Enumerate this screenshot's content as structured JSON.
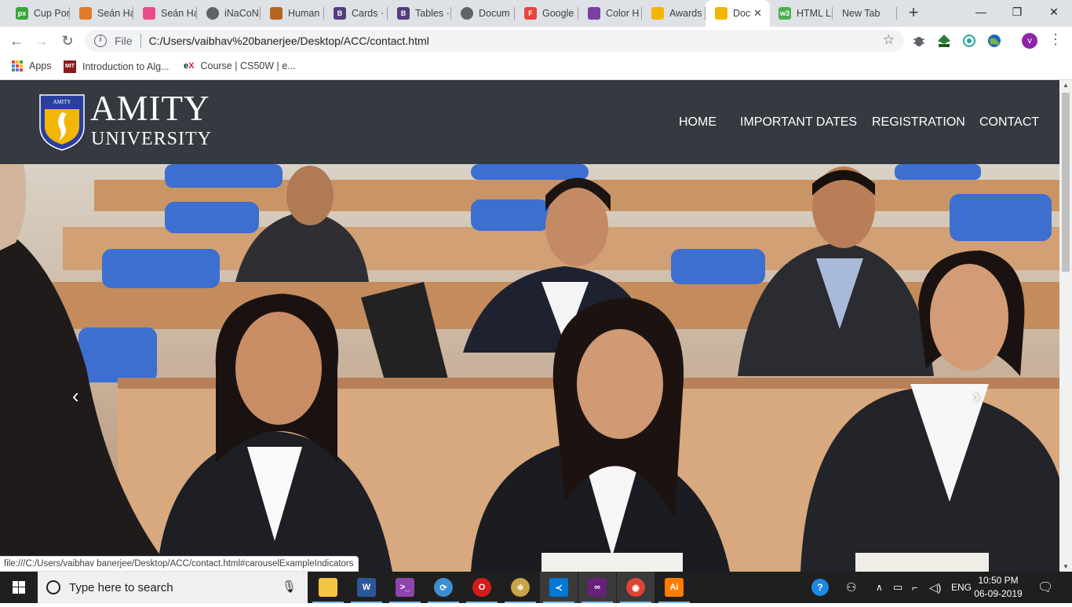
{
  "browser": {
    "tabs": [
      {
        "title": "Cup Por",
        "icon": "px-icon",
        "color": "#3aa53a",
        "glyph": "px",
        "active": false
      },
      {
        "title": "Seán Ha",
        "icon": "sean-icon",
        "color": "#e07b2a",
        "glyph": "",
        "active": false
      },
      {
        "title": "Seán Ha",
        "icon": "dribbble-icon",
        "color": "#ea4c89",
        "glyph": "",
        "active": false
      },
      {
        "title": "iNaCoN",
        "icon": "globe-icon",
        "color": "#5f6368",
        "glyph": "",
        "active": false
      },
      {
        "title": "Human",
        "icon": "human-icon",
        "color": "#b5651d",
        "glyph": "",
        "active": false
      },
      {
        "title": "Cards ·",
        "icon": "bootstrap-icon",
        "color": "#563d7c",
        "glyph": "B",
        "active": false
      },
      {
        "title": "Tables ·",
        "icon": "bootstrap-icon",
        "color": "#563d7c",
        "glyph": "B",
        "active": false
      },
      {
        "title": "Docum",
        "icon": "globe-icon",
        "color": "#5f6368",
        "glyph": "",
        "active": false
      },
      {
        "title": "Google",
        "icon": "forms-icon",
        "color": "#e8453c",
        "glyph": "F",
        "active": false
      },
      {
        "title": "Color H",
        "icon": "colorhunt-icon",
        "color": "#7b3fa0",
        "glyph": "",
        "active": false
      },
      {
        "title": "Awards",
        "icon": "amity-icon",
        "color": "#f2b705",
        "glyph": "",
        "active": false
      },
      {
        "title": "Doc",
        "icon": "amity-icon",
        "color": "#f2b705",
        "glyph": "",
        "active": true
      },
      {
        "title": "HTML L",
        "icon": "w3-icon",
        "color": "#4caf50",
        "glyph": "w3",
        "active": false
      },
      {
        "title": "New Tab",
        "icon": "",
        "color": "",
        "glyph": "",
        "active": false
      }
    ],
    "new_tab_symbol": "+",
    "window": {
      "minimize": "—",
      "maximize": "❐",
      "close": "✕"
    },
    "address": {
      "scheme_label": "File",
      "url": "C:/Users/vaibhav%20banerjee/Desktop/ACC/contact.html",
      "star": "☆"
    },
    "nav": {
      "back": "←",
      "forward": "→",
      "reload": "↻"
    },
    "profile_initial": "v",
    "menu_symbol": "⋮",
    "extensions": [
      {
        "name": "bug-extension-icon",
        "color": "#5f6368"
      },
      {
        "name": "html-extension-icon",
        "color": "#2e7d32"
      },
      {
        "name": "gem-extension-icon",
        "color": "#26a69a"
      },
      {
        "name": "globe-extension-icon",
        "color": "#7cb342"
      }
    ],
    "bookmarks": [
      {
        "label": "Apps",
        "icon": "apps-grid-icon"
      },
      {
        "label": "Introduction to Alg...",
        "icon": "mit-ocw-icon"
      },
      {
        "label": "Course | CS50W | e...",
        "icon": "edx-icon"
      }
    ]
  },
  "site": {
    "logo": {
      "name": "AMITY",
      "sub": "UNIVERSITY",
      "crest_label": "AMITY UNIVERSITY"
    },
    "nav": [
      "HOME",
      "IMPORTANT DATES",
      "REGISTRATION",
      "CONTACT"
    ],
    "carousel": {
      "prev": "‹",
      "next": "›"
    },
    "status_url": "file:///C:/Users/vaibhav banerjee/Desktop/ACC/contact.html#carouselExampleIndicators"
  },
  "taskbar": {
    "search_placeholder": "Type here to search",
    "apps": [
      {
        "name": "file-explorer",
        "color": "#f4c542",
        "glyph": "",
        "active": false
      },
      {
        "name": "word",
        "color": "#2b579a",
        "glyph": "W",
        "active": false
      },
      {
        "name": "terminal",
        "color": "#8e44ad",
        "glyph": ">_",
        "active": false
      },
      {
        "name": "sync",
        "color": "#3b8ed0",
        "glyph": "⟳",
        "active": false
      },
      {
        "name": "opera",
        "color": "#d81a1a",
        "glyph": "O",
        "active": false
      },
      {
        "name": "atom",
        "color": "#c8a348",
        "glyph": "⚛",
        "active": false
      },
      {
        "name": "vscode",
        "color": "#0078d4",
        "glyph": "≺",
        "active": true
      },
      {
        "name": "visual-studio",
        "color": "#68217a",
        "glyph": "∞",
        "active": true
      },
      {
        "name": "chrome",
        "color": "#db4437",
        "glyph": "◉",
        "active": true
      },
      {
        "name": "illustrator",
        "color": "#ff7c00",
        "glyph": "Ai",
        "active": false
      }
    ],
    "tray": {
      "language": "ENG",
      "time": "10:50 PM",
      "date": "06-09-2019"
    }
  }
}
